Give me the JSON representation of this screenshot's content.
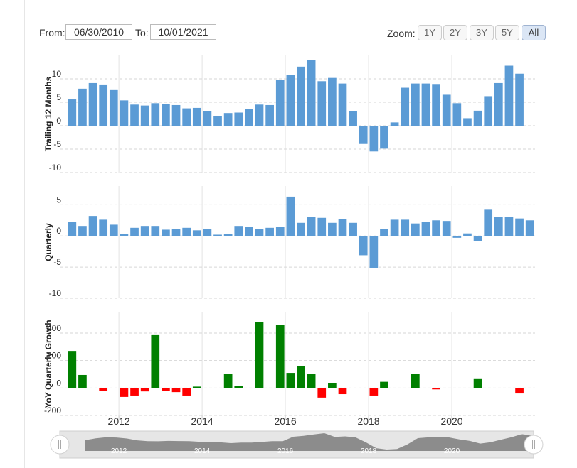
{
  "controls": {
    "from_label": "From:",
    "from_value": "06/30/2010",
    "to_label": "To:",
    "to_value": "10/01/2021",
    "zoom_label": "Zoom:",
    "zoom_options": [
      "1Y",
      "2Y",
      "3Y",
      "5Y",
      "All"
    ],
    "zoom_selected": "All"
  },
  "chart_data": {
    "type": "bar",
    "x_start": "2010-10",
    "period": "quarter",
    "x_ticks": [
      "2012",
      "2014",
      "2016",
      "2018",
      "2020"
    ],
    "colors": {
      "trailing": "#5b9bd5",
      "quarterly": "#5b9bd5",
      "positive": "#008000",
      "negative": "#ff0000"
    },
    "grid": true,
    "panels": [
      {
        "name": "trailing",
        "ylabel": "Trailing 12 Months",
        "ylim": [
          -10,
          15
        ],
        "yticks": [
          10,
          5,
          0,
          -5,
          -10
        ],
        "values": [
          5.6,
          7.9,
          9.1,
          8.8,
          7.6,
          5.4,
          4.5,
          4.3,
          4.8,
          4.6,
          4.4,
          3.7,
          3.8,
          3.1,
          2.1,
          2.7,
          2.8,
          3.6,
          4.5,
          4.4,
          9.8,
          10.8,
          12.6,
          14.0,
          9.5,
          10.2,
          9.0,
          3.1,
          -3.9,
          -5.5,
          -4.9,
          0.7,
          8.1,
          9.0,
          9.0,
          8.9,
          6.6,
          4.8,
          1.6,
          3.2,
          6.3,
          9.1,
          12.8,
          11.1
        ]
      },
      {
        "name": "quarterly",
        "ylabel": "Quarterly",
        "ylim": [
          -10,
          8
        ],
        "yticks": [
          5,
          0,
          -5,
          -10
        ],
        "values": [
          2.2,
          1.6,
          3.2,
          2.6,
          1.8,
          0.3,
          1.3,
          1.6,
          1.6,
          1.0,
          1.1,
          1.3,
          0.9,
          1.1,
          0.2,
          0.3,
          1.6,
          1.4,
          1.1,
          1.3,
          1.5,
          6.3,
          2.1,
          3.0,
          2.9,
          2.1,
          2.7,
          2.1,
          -3.1,
          -5.1,
          1.1,
          2.6,
          2.6,
          2.0,
          2.2,
          2.5,
          2.4,
          -0.3,
          0.4,
          -0.8,
          4.2,
          3.0,
          3.1,
          2.8,
          2.5
        ]
      },
      {
        "name": "yoy",
        "ylabel": "YoY Quarterly Growth",
        "ylim": [
          -200,
          550
        ],
        "yticks": [
          400,
          200,
          0,
          -200
        ],
        "values": [
          270,
          95,
          0,
          -20,
          0,
          -65,
          -55,
          -25,
          385,
          -20,
          -30,
          -55,
          10,
          0,
          0,
          100,
          15,
          0,
          480,
          0,
          460,
          110,
          160,
          105,
          -70,
          35,
          -45,
          0,
          0,
          -55,
          45,
          0,
          0,
          105,
          0,
          -10,
          0,
          0,
          0,
          70,
          0,
          0,
          0,
          -40
        ]
      }
    ],
    "navigator": {
      "x_ticks": [
        "2012",
        "2014",
        "2016",
        "2018",
        "2020"
      ]
    }
  }
}
